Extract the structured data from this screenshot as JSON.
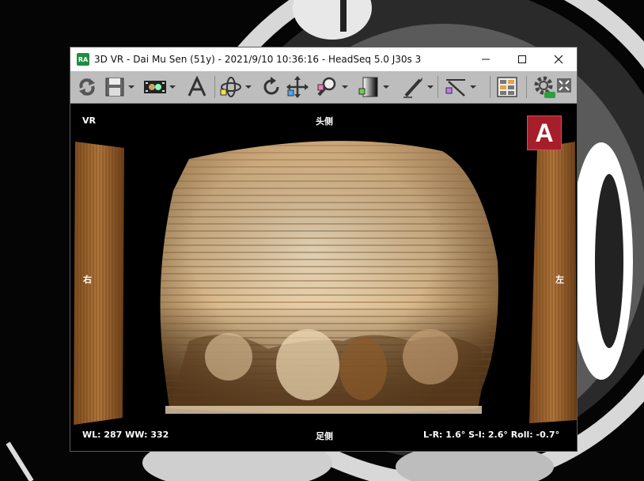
{
  "window": {
    "app_icon_label": "RA",
    "title": "3D VR - Dai Mu Sen (51y) - 2021/9/10 10:36:16 - HeadSeq  5.0  J30s  3"
  },
  "toolbar": {
    "items": [
      "sync-icon",
      "save-icon",
      "cine-icon",
      "annotation-text-icon",
      "rotate-3d-icon",
      "rotate-icon",
      "pan-icon",
      "zoom-icon",
      "window-level-icon",
      "measure-pen-icon",
      "cut-plane-icon",
      "layout-icon",
      "gpu-settings-icon",
      "fullscreen-icon"
    ]
  },
  "viewport": {
    "mode": "VR",
    "top_label": "头侧",
    "bottom_label": "足侧",
    "left_label": "右",
    "right_label": "左",
    "wl_ww": "WL: 287 WW: 332",
    "rotation": "L-R: 1.6° S-I: 2.6° Roll: -0.7°",
    "orientation_cube_letter": "A"
  },
  "colors": {
    "toolbar_bg": "#bdbdbd",
    "cube_red": "#a61e2a",
    "bone": "#e8cfa8"
  }
}
